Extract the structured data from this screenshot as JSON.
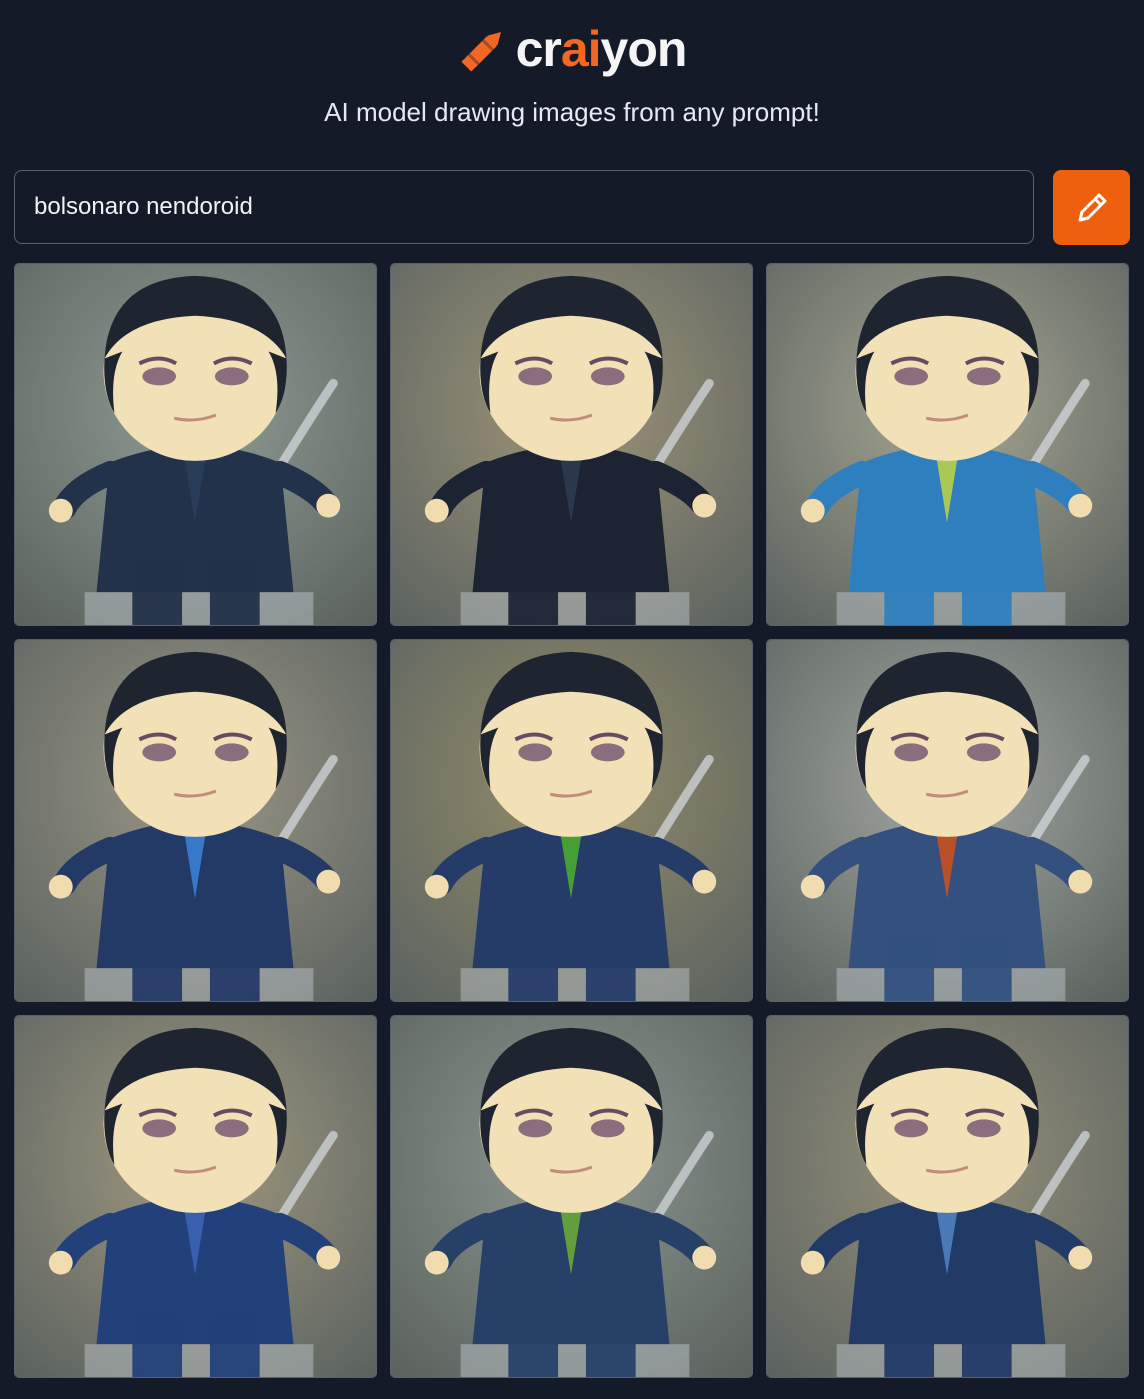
{
  "header": {
    "logo": {
      "prefix": "cr",
      "highlight": "ai",
      "suffix": "yon"
    },
    "tagline": "AI model drawing images from any prompt!"
  },
  "search": {
    "value": "bolsonaro nendoroid",
    "button_icon": "pencil-icon"
  },
  "colors": {
    "background": "#141a28",
    "accent": "#ee5f10",
    "logo_ai": "#f26722"
  },
  "images": [
    {
      "bg": "#8f9c94",
      "suit": "#22324a",
      "accent": "#2a3d5a"
    },
    {
      "bg": "#9e9478",
      "suit": "#1c2434",
      "accent": "#2e3a4e"
    },
    {
      "bg": "#a6a692",
      "suit": "#2f7fbf",
      "accent": "#b8d04a"
    },
    {
      "bg": "#9a9686",
      "suit": "#243a66",
      "accent": "#3a7fd6"
    },
    {
      "bg": "#948c6a",
      "suit": "#263c68",
      "accent": "#4aa832"
    },
    {
      "bg": "#a4a8a4",
      "suit": "#33507e",
      "accent": "#c8501e"
    },
    {
      "bg": "#a09880",
      "suit": "#22407a",
      "accent": "#3c64b4"
    },
    {
      "bg": "#8c9690",
      "suit": "#264068",
      "accent": "#6aa83a"
    },
    {
      "bg": "#96907a",
      "suit": "#223a66",
      "accent": "#5080c0"
    }
  ]
}
